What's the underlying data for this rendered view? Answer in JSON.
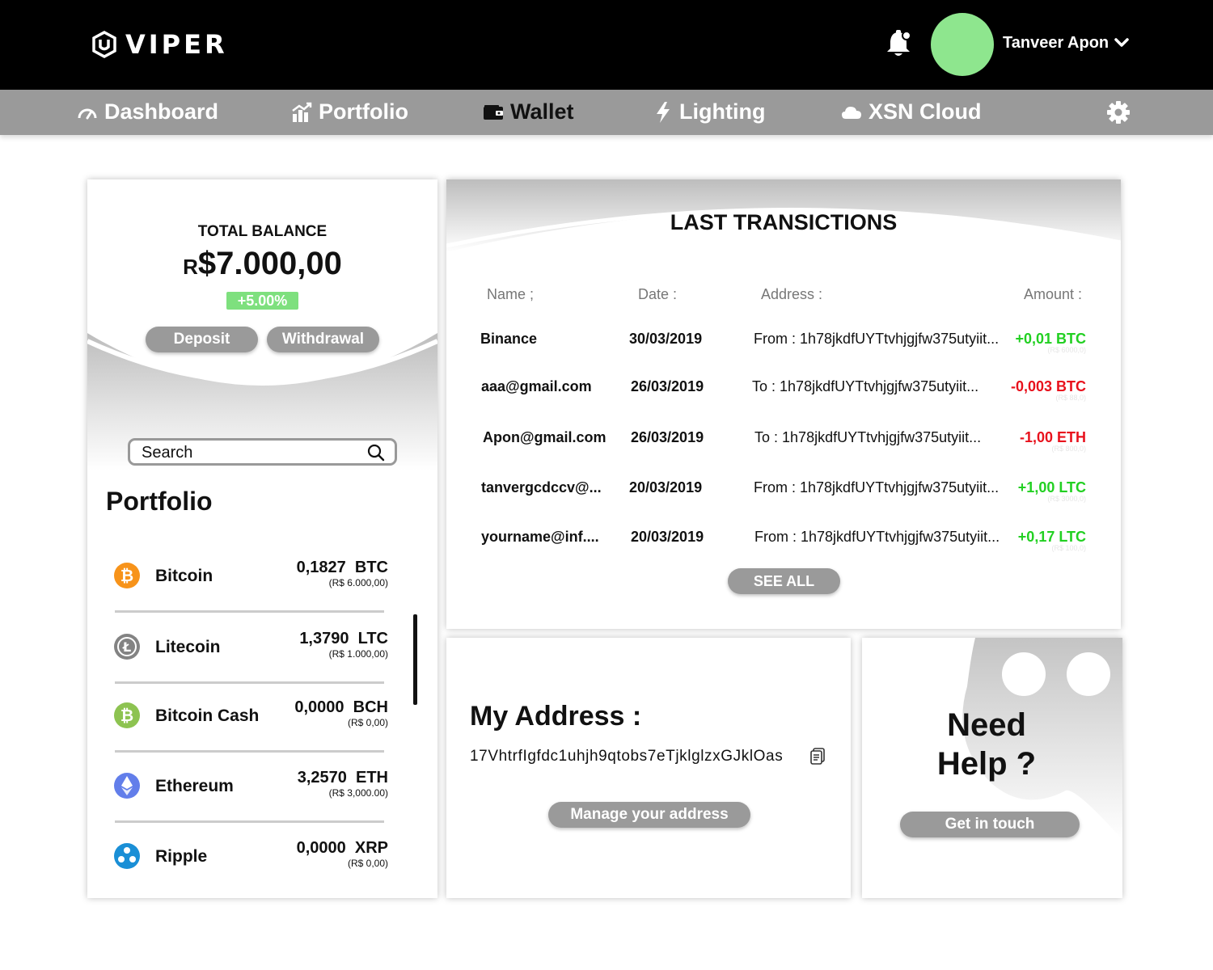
{
  "header": {
    "brand": "VIPER",
    "user_name": "Tanveer Apon",
    "avatar_color": "#8ee68e"
  },
  "nav": {
    "items": [
      {
        "label": "Dashboard",
        "icon": "gauge-icon"
      },
      {
        "label": "Portfolio",
        "icon": "chart-icon"
      },
      {
        "label": "Wallet",
        "icon": "wallet-icon"
      },
      {
        "label": "Lighting",
        "icon": "lightning-icon"
      },
      {
        "label": "XSN Cloud",
        "icon": "cloud-icon"
      }
    ],
    "settings_icon": "gear-icon"
  },
  "balance": {
    "label": "TOTAL BALANCE",
    "currency": "R",
    "value": "$7.000,00",
    "change": "+5.00%",
    "deposit_label": "Deposit",
    "withdraw_label": "Withdrawal"
  },
  "search": {
    "placeholder": "Search"
  },
  "portfolio": {
    "title": "Portfolio",
    "coins": [
      {
        "name": "Bitcoin",
        "amount": "0,1827  BTC",
        "fiat": "(R$ 6.000,00)",
        "icon": "bitcoin-icon",
        "color": "#f7931a"
      },
      {
        "name": "Litecoin",
        "amount": "1,3790  LTC",
        "fiat": "(R$ 1.000,00)",
        "icon": "litecoin-icon",
        "color": "#838383"
      },
      {
        "name": "Bitcoin Cash",
        "amount": "0,0000  BCH",
        "fiat": "(R$ 0,00)",
        "icon": "bitcoin-cash-icon",
        "color": "#8dc351"
      },
      {
        "name": "Ethereum",
        "amount": "3,2570  ETH",
        "fiat": "(R$ 3,000.00)",
        "icon": "ethereum-icon",
        "color": "#627eea"
      },
      {
        "name": "Ripple",
        "amount": "0,0000  XRP",
        "fiat": "(R$ 0,00)",
        "icon": "ripple-icon",
        "color": "#1a8fd6"
      }
    ]
  },
  "transactions": {
    "title": "LAST TRANSICTIONS",
    "headers": {
      "name": "Name ;",
      "date": "Date :",
      "address": "Address :",
      "amount": "Amount :"
    },
    "rows": [
      {
        "name": "Binance",
        "date": "30/03/2019",
        "direction": "From :",
        "address": "1h78jkdfUYTtvhjgjfw375utyiit...",
        "amount": "+0,01 BTC",
        "fiat": "(R$ 6000,0)",
        "positive": true
      },
      {
        "name": "aaa@gmail.com",
        "date": "26/03/2019",
        "direction": "To :",
        "address": "1h78jkdfUYTtvhjgjfw375utyiit...",
        "amount": "-0,003 BTC",
        "fiat": "(R$ 88,0)",
        "positive": false
      },
      {
        "name": "Apon@gmail.com",
        "date": "26/03/2019",
        "direction": "To :",
        "address": "1h78jkdfUYTtvhjgjfw375utyiit...",
        "amount": "-1,00 ETH",
        "fiat": "(R$ 800,0)",
        "positive": false
      },
      {
        "name": "tanvergcdccv@...",
        "date": "20/03/2019",
        "direction": "From :",
        "address": "1h78jkdfUYTtvhjgjfw375utyiit...",
        "amount": "+1,00 LTC",
        "fiat": "(R$ 3000,0)",
        "positive": true
      },
      {
        "name": "yourname@inf....",
        "date": "20/03/2019",
        "direction": "From :",
        "address": "1h78jkdfUYTtvhjgjfw375utyiit...",
        "amount": "+0,17 LTC",
        "fiat": "(R$ 100,0)",
        "positive": true
      }
    ],
    "see_all_label": "SEE ALL",
    "positive_color": "#22d022",
    "negative_color": "#e8111c"
  },
  "address": {
    "title": "My Address :",
    "value": "17VhtrfIgfdc1uhjh9qtobs7eTjklglzxGJklOas",
    "manage_label": "Manage your address"
  },
  "help": {
    "title": "Need Help ?",
    "button_label": "Get in touch"
  }
}
